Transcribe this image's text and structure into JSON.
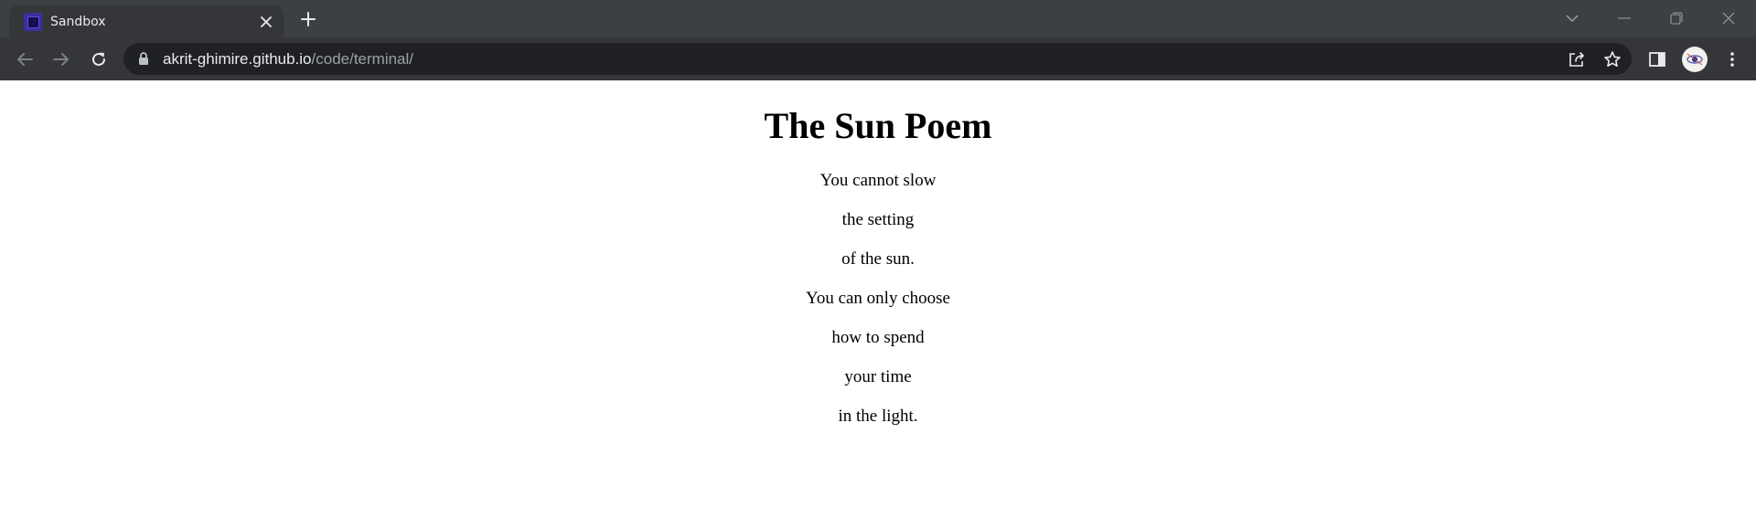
{
  "browser": {
    "tab": {
      "title": "Sandbox",
      "favicon": "sandbox-favicon"
    },
    "address_bar": {
      "host": "akrit-ghimire.github.io",
      "path": "/code/terminal/"
    },
    "icons": {
      "back": "arrow-left-icon",
      "forward": "arrow-right-icon",
      "reload": "reload-icon",
      "lock": "lock-icon",
      "share": "share-icon",
      "bookmark": "star-icon",
      "side_panel": "side-panel-icon",
      "menu": "kebab-menu-icon",
      "new_tab": "plus-icon",
      "tab_close": "close-icon",
      "tab_search": "chevron-down-icon",
      "minimize": "minimize-icon",
      "restore": "restore-icon",
      "close_window": "close-icon"
    },
    "colors": {
      "tabstrip": "#3c3f43",
      "toolbar": "#35363a",
      "omnibox": "#202124"
    }
  },
  "page": {
    "title": "The Sun Poem",
    "lines": [
      "You cannot slow",
      "the setting",
      "of the sun.",
      "You can only choose",
      "how to spend",
      "your time",
      "in the light."
    ]
  }
}
